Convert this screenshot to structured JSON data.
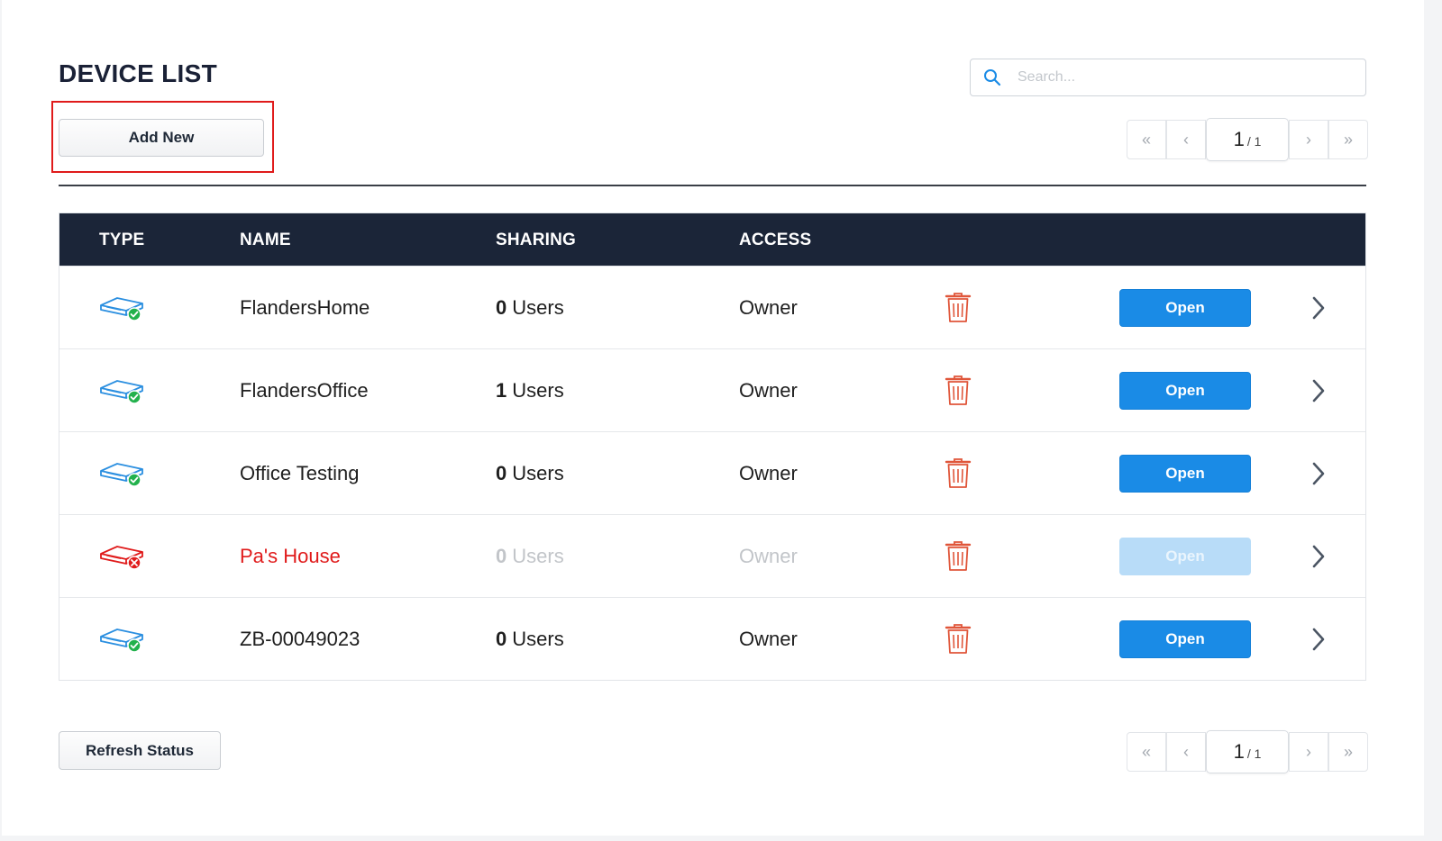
{
  "page": {
    "title": "DEVICE LIST"
  },
  "search": {
    "placeholder": "Search..."
  },
  "toolbar": {
    "add_label": "Add New",
    "refresh_label": "Refresh Status"
  },
  "pagination": {
    "current": "1",
    "total": "/ 1",
    "first": "«",
    "prev": "‹",
    "next": "›",
    "last": "»"
  },
  "table": {
    "headers": {
      "type": "TYPE",
      "name": "NAME",
      "sharing": "SHARING",
      "access": "ACCESS"
    },
    "rows": [
      {
        "name": "FlandersHome",
        "sharing_count": "0",
        "sharing_unit": "Users",
        "access": "Owner",
        "status": "online",
        "open_label": "Open"
      },
      {
        "name": "FlandersOffice",
        "sharing_count": "1",
        "sharing_unit": "Users",
        "access": "Owner",
        "status": "online",
        "open_label": "Open"
      },
      {
        "name": "Office Testing",
        "sharing_count": "0",
        "sharing_unit": "Users",
        "access": "Owner",
        "status": "online",
        "open_label": "Open"
      },
      {
        "name": "Pa's House",
        "sharing_count": "0",
        "sharing_unit": "Users",
        "access": "Owner",
        "status": "offline",
        "open_label": "Open"
      },
      {
        "name": "ZB-00049023",
        "sharing_count": "0",
        "sharing_unit": "Users",
        "access": "Owner",
        "status": "online",
        "open_label": "Open"
      }
    ]
  },
  "icons": {
    "search": "search-icon",
    "device": "router-device-icon",
    "online_badge": "check-badge-icon",
    "offline_badge": "error-badge-icon",
    "delete": "trash-icon",
    "row_arrow": "chevron-right-icon"
  },
  "colors": {
    "header_bg": "#1b2538",
    "primary": "#1a8be6",
    "danger": "#e01b1b",
    "delete": "#e0563a",
    "online": "#22b14c",
    "device_online": "#2b8fe0"
  }
}
